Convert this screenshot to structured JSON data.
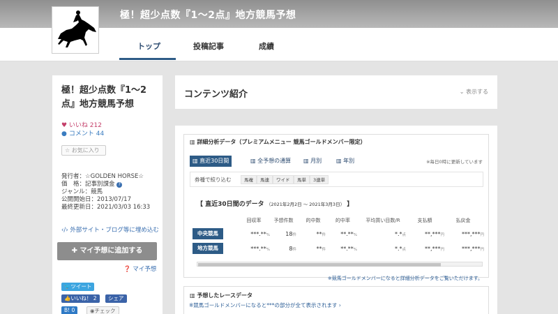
{
  "header": {
    "site_title": "極！超少点数『1～2点』地方競馬予想",
    "tabs": [
      {
        "label": "トップ",
        "active": true
      },
      {
        "label": "投稿記事",
        "active": false
      },
      {
        "label": "成績",
        "active": false
      }
    ],
    "accent_color": "#2d5b86"
  },
  "sidebar": {
    "title": "極！超少点数『1～2点』地方競馬予想",
    "likes_label": "いいね",
    "likes_count": "212",
    "comments_label": "コメント",
    "comments_count": "44",
    "favorite_label": "お気に入り",
    "meta": {
      "publisher": "発行者：☆GOLDEN HORSE☆",
      "price": "価　格：記事別課金",
      "genre": "ジャンル：競馬",
      "start_date": "公開開始日：2013/07/17",
      "updated": "最終更新日：2021/03/03 16:33"
    },
    "embed_link": "外部サイト・ブログ等に埋め込む",
    "add_button": "マイ予想に追加する",
    "my_yoso_link": "マイ予想",
    "share": {
      "tweet": "ツイート",
      "fb_like": "いいね！ 2",
      "fb_share": "シェア",
      "hatena": "B! 0",
      "check": "チェック"
    }
  },
  "content_head": {
    "title": "コンテンツ紹介",
    "show_link": "表示する"
  },
  "analysis": {
    "title": "詳細分析データ（プレミアムメニュー 競馬ゴールドメンバー限定）",
    "tabs": [
      "直近30日間",
      "全予想の通算",
      "月別",
      "年別"
    ],
    "update_note": "※毎日0時に更新しています",
    "filter_label": "券種で絞り込む",
    "filters": [
      "馬複",
      "馬連",
      "ワイド",
      "馬単",
      "3連単"
    ],
    "period_label": "【 直近30日間のデータ",
    "period_range": "（2021年2月2日 ～ 2021年3月3日）",
    "period_end": "】",
    "columns": [
      "回収率",
      "予想件数",
      "的中数",
      "的中率",
      "平均買い目数/R",
      "支払額",
      "払戻金"
    ],
    "rows": [
      {
        "label": "中央競馬",
        "cells": [
          "***.**",
          "18",
          "**",
          "**.**",
          "*.*",
          "**,***",
          "***,***"
        ]
      },
      {
        "label": "地方競馬",
        "cells": [
          "***.**",
          "8",
          "**",
          "**.**",
          "*.*",
          "**,***",
          "***,***"
        ]
      }
    ],
    "units": [
      "%",
      "件",
      "件",
      "%",
      "点",
      "円",
      "円"
    ],
    "member_note": "※競馬ゴールドメンバーになると詳細分析データをご覧いただけます。"
  },
  "race_data": {
    "title": "予想したレースデータ",
    "note": "※競馬ゴールドメンバーになると***の部分が全て表示されます ›"
  }
}
